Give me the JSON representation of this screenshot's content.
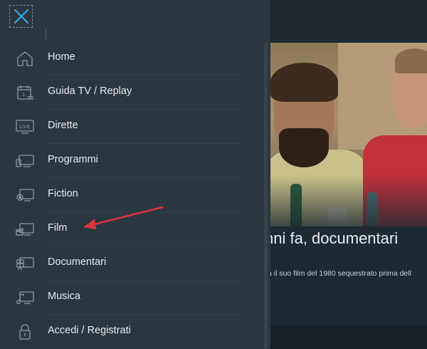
{
  "drawer": {
    "close_icon": "close-x-icon",
    "items": [
      {
        "label": "Home",
        "icon": "home-icon"
      },
      {
        "label": "Guida TV / Replay",
        "icon": "calendar-guide-icon"
      },
      {
        "label": "Dirette",
        "icon": "live-tv-icon"
      },
      {
        "label": "Programmi",
        "icon": "tv-programs-icon"
      },
      {
        "label": "Fiction",
        "icon": "fiction-camera-icon"
      },
      {
        "label": "Film",
        "icon": "film-clapper-icon"
      },
      {
        "label": "Documentari",
        "icon": "documentary-camera-icon"
      },
      {
        "label": "Musica",
        "icon": "music-note-icon"
      },
      {
        "label": "Accedi / Registrati",
        "icon": "lock-icon"
      }
    ]
  },
  "hero": {
    "title": "nni fa, documentari",
    "description": "a il suo film del 1980 sequestrato prima dell"
  },
  "colors": {
    "drawer_bg": "#2a3640",
    "accent": "#3aa3e3",
    "annotation_arrow": "#d9363e"
  }
}
